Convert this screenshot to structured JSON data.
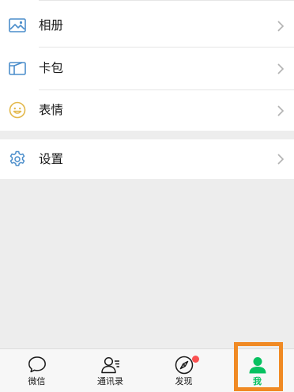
{
  "menu": {
    "group1": [
      {
        "label": "相册",
        "icon": "photo-album-icon"
      },
      {
        "label": "卡包",
        "icon": "card-wallet-icon"
      },
      {
        "label": "表情",
        "icon": "smiley-icon"
      }
    ],
    "group2": [
      {
        "label": "设置",
        "icon": "gear-icon"
      }
    ]
  },
  "tabbar": {
    "tabs": [
      {
        "label": "微信",
        "icon": "chat-bubble-icon",
        "active": false
      },
      {
        "label": "通讯录",
        "icon": "contacts-icon",
        "active": false
      },
      {
        "label": "发现",
        "icon": "compass-icon",
        "active": false,
        "badge": "dot"
      },
      {
        "label": "我",
        "icon": "person-icon",
        "active": true
      }
    ]
  },
  "colors": {
    "accent_green": "#07c160",
    "icon_blue": "#4c8ecb",
    "icon_yellow": "#e3b84a",
    "badge_red": "#fa5151",
    "highlight_orange": "#f08a24",
    "background": "#ededed"
  }
}
